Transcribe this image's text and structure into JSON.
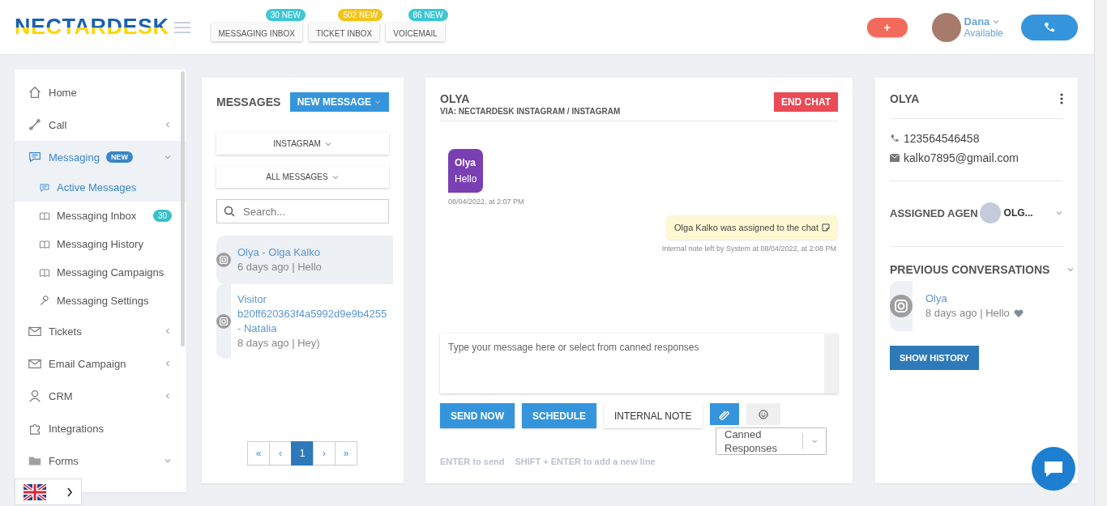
{
  "header": {
    "logo": "NECTARDESK",
    "tabs": [
      {
        "label": "MESSAGING INBOX",
        "badge": "30 NEW",
        "color": "#3ec6d3"
      },
      {
        "label": "TICKET INBOX",
        "badge": "502 NEW",
        "color": "#f2c31a"
      },
      {
        "label": "VOICEMAIL",
        "badge": "86 NEW",
        "color": "#3ec6d3"
      }
    ],
    "add_button": "+",
    "user": {
      "name": "Dana",
      "status": "Available"
    }
  },
  "sidebar": {
    "items": [
      {
        "label": "Home",
        "selected": false
      },
      {
        "label": "Call",
        "expanded": false,
        "selected": false
      },
      {
        "label": "Messaging",
        "badge": "NEW",
        "expanded": true,
        "selected": true,
        "children": [
          {
            "label": "Active Messages",
            "selected": true
          },
          {
            "label": "Messaging Inbox",
            "badge": "30",
            "selected": false
          },
          {
            "label": "Messaging History",
            "selected": false
          },
          {
            "label": "Messaging Campaigns",
            "selected": false
          },
          {
            "label": "Messaging Settings",
            "selected": false
          }
        ]
      },
      {
        "label": "Tickets",
        "expanded": false,
        "selected": false
      },
      {
        "label": "Email Campaign",
        "expanded": false,
        "selected": false
      },
      {
        "label": "CRM",
        "expanded": false,
        "selected": false
      },
      {
        "label": "Integrations",
        "selected": false
      },
      {
        "label": "Forms",
        "expanded": true,
        "selected": false
      }
    ]
  },
  "messages_panel": {
    "title": "MESSAGES",
    "new_button": "NEW MESSAGE",
    "channel_filter": "INSTAGRAM",
    "status_filter": "ALL MESSAGES",
    "search": {
      "placeholder": "Search..."
    },
    "conversations": [
      {
        "name": "Olya - Olga Kalko",
        "meta": "6 days ago | Hello",
        "selected": true
      },
      {
        "name": "Visitor b20ff620363f4a5992d9e9b4255 - Natalia",
        "meta": "8 days ago | Hey)",
        "selected": false
      }
    ],
    "pagination": [
      {
        "label": "«",
        "selected": false
      },
      {
        "label": "‹",
        "selected": false
      },
      {
        "label": "1",
        "selected": true
      },
      {
        "label": "›",
        "selected": false
      },
      {
        "label": "»",
        "selected": false
      }
    ]
  },
  "chat": {
    "title": "OLYA",
    "via": "VIA: NECTARDESK INSTAGRAM / INSTAGRAM",
    "end_button": "END CHAT",
    "messages": [
      {
        "kind": "incoming",
        "sender": "Olya",
        "text": "Hello",
        "meta": "08/04/2022, at 2:07 PM"
      },
      {
        "kind": "note",
        "text": "Olga Kalko was assigned to the chat",
        "meta": "Internal note left by System at 08/04/2022, at 2:08 PM"
      }
    ],
    "composer": {
      "placeholder": "Type your message here or select from canned responses"
    },
    "buttons": [
      {
        "label": "SEND NOW",
        "kind": "primary"
      },
      {
        "label": "SCHEDULE",
        "kind": "primary"
      },
      {
        "label": "INTERNAL NOTE",
        "kind": "plain"
      }
    ],
    "canned": {
      "placeholder": "Canned Responses"
    },
    "hints": [
      "ENTER to send",
      "SHIFT + ENTER to add a new line"
    ]
  },
  "contact": {
    "name": "OLYA",
    "phone": "123564546458",
    "email": "kalko7895@gmail.com",
    "assigned_label": "ASSIGNED AGEN",
    "agent": "OLG...",
    "previous_title": "PREVIOUS CONVERSATIONS",
    "previous": [
      {
        "name": "Olya",
        "meta": "8 days ago | Hello"
      }
    ],
    "history_button": "SHOW HISTORY"
  }
}
